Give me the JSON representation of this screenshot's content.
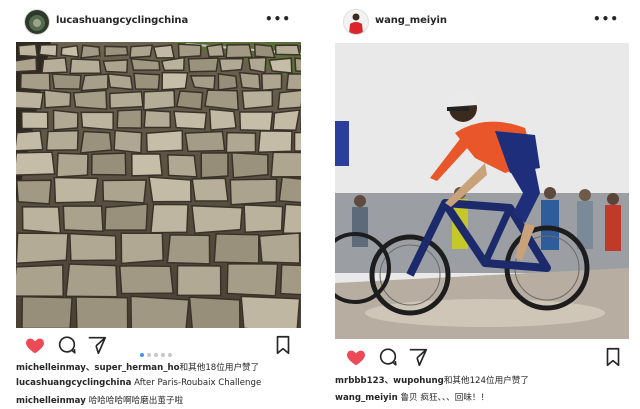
{
  "post_left": {
    "username": "lucashuangcyclingchina",
    "likes_line": {
      "users": "michelleinmay、super_herman_ho",
      "rest": "和其他18位用户赞了"
    },
    "caption": {
      "user": "lucashuangcyclingchina",
      "text": "After Paris-Roubaix Challenge"
    },
    "comment": {
      "user": "michelleinmay",
      "text": "哈哈哈哈啊哈磨出茧子啦"
    },
    "carousel": {
      "count": 5,
      "active_index": 0
    },
    "liked": true
  },
  "post_right": {
    "username": "wang_meiyin",
    "likes_line": {
      "users": "mrbbb123、wupohung",
      "rest": "和其他124位用户赞了"
    },
    "caption": {
      "user": "wang_meiyin",
      "text": "鲁贝 疯狂、、、回味！！"
    },
    "liked": true
  },
  "colors": {
    "like_red": "#ed4956",
    "carousel_active": "#3897f0",
    "text": "#262626"
  },
  "icons": [
    "heart-icon",
    "comment-icon",
    "share-icon",
    "bookmark-icon",
    "more-icon"
  ]
}
